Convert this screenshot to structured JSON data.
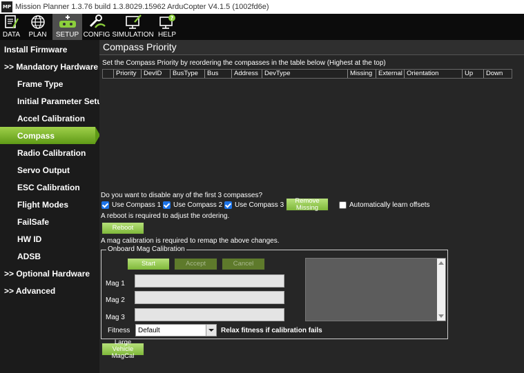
{
  "window": {
    "title": "Mission Planner 1.3.76 build 1.3.8029.15962 ArduCopter V4.1.5 (1002fd6e)",
    "icon_text": "MP"
  },
  "toolbar": {
    "items": [
      {
        "label": "DATA",
        "icon": "data-icon"
      },
      {
        "label": "PLAN",
        "icon": "globe-icon"
      },
      {
        "label": "SETUP",
        "icon": "setup-icon",
        "active": true
      },
      {
        "label": "CONFIG",
        "icon": "wrench-icon"
      },
      {
        "label": "SIMULATION",
        "icon": "simulation-icon"
      },
      {
        "label": "HELP",
        "icon": "help-icon"
      }
    ]
  },
  "sidebar": {
    "items": [
      {
        "label": "Install Firmware"
      },
      {
        "label": ">> Mandatory Hardware"
      },
      {
        "label": "Frame Type"
      },
      {
        "label": "Initial Parameter Setup"
      },
      {
        "label": "Accel Calibration"
      },
      {
        "label": "Compass",
        "active": true
      },
      {
        "label": "Radio Calibration"
      },
      {
        "label": "Servo Output"
      },
      {
        "label": "ESC Calibration"
      },
      {
        "label": "Flight Modes"
      },
      {
        "label": "FailSafe"
      },
      {
        "label": "HW ID"
      },
      {
        "label": "ADSB"
      },
      {
        "label": ">> Optional Hardware"
      },
      {
        "label": ">> Advanced"
      }
    ]
  },
  "main": {
    "title": "Compass Priority",
    "instructions": "Set the Compass Priority by reordering the compasses in the table below (Highest at the top)",
    "table": {
      "columns": [
        "Priority",
        "DevID",
        "BusType",
        "Bus",
        "Address",
        "DevType",
        "Missing",
        "External",
        "Orientation",
        "Up",
        "Down"
      ]
    },
    "disable_question": "Do you want to disable any of the first 3 compasses?",
    "use_compass": [
      {
        "label": "Use Compass 1",
        "checked": true
      },
      {
        "label": "Use Compass 2",
        "checked": true
      },
      {
        "label": "Use Compass 3",
        "checked": true
      }
    ],
    "remove_missing_label": "Remove Missing",
    "auto_learn": {
      "label": "Automatically learn offsets",
      "checked": false
    },
    "reboot_note": "A reboot is required to adjust the ordering.",
    "reboot_label": "Reboot",
    "mag_note": "A mag calibration is required to remap the above changes.",
    "onboard": {
      "title": "Onboard Mag Calibration",
      "start_label": "Start",
      "accept_label": "Accept",
      "cancel_label": "Cancel",
      "mag1_label": "Mag 1",
      "mag2_label": "Mag 2",
      "mag3_label": "Mag 3",
      "fitness_label": "Fitness",
      "fitness_value": "Default",
      "relax_label": "Relax fitness if calibration fails"
    },
    "large_vehicle_label": "Large Vehicle MagCal"
  },
  "colors": {
    "accent_green": "#7fb83a",
    "checkbox_blue": "#1b73e8",
    "background": "#262626"
  }
}
